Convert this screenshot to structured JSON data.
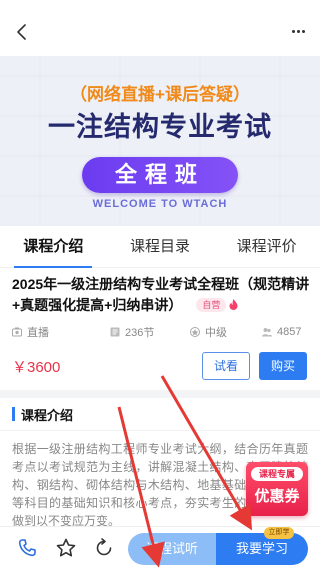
{
  "banner": {
    "subtitle": "（网络直播+课后答疑）",
    "title": "一注结构专业考试",
    "pill": "全程班",
    "welcome": "WELCOME TO WTACH"
  },
  "tabs": [
    {
      "label": "课程介绍",
      "active": true
    },
    {
      "label": "课程目录",
      "active": false
    },
    {
      "label": "课程评价",
      "active": false
    }
  ],
  "course": {
    "title": "2025年一级注册结构专业考试全程班（规范精讲+真题强化提高+归纳串讲）",
    "badge": "自营",
    "meta": {
      "type": "直播",
      "lessons": "236节",
      "level": "中级",
      "students": "4857"
    },
    "price": "￥3600",
    "try_label": "试看",
    "buy_label": "购买"
  },
  "intro": {
    "heading": "课程介绍",
    "text": "根据一级注册结构工程师专业考试大纲，结合历年真题考点以考试规范为主线，讲解混凝土结构、高层建筑结构、钢结构、砌体结构与木结构、地基基础、桥梁结构等科目的基础知识和核心考点，夯实考生的理论基础，做到以不变应万变。"
  },
  "coupon": {
    "top": "课程专属",
    "main": "优惠券"
  },
  "bottom": {
    "trial_label": "课程试听",
    "study_label": "我要学习",
    "study_badge": "立即学"
  },
  "colors": {
    "accent": "#2d7cf2",
    "price": "#e8334a",
    "banner_pill": "#7646f4",
    "annotation_arrow": "#e53935"
  },
  "icons": {
    "back": "back-chevron-icon",
    "more": "more-dots-icon",
    "phone": "phone-icon",
    "star": "star-icon",
    "share": "share-refresh-icon",
    "fire": "fire-icon"
  }
}
